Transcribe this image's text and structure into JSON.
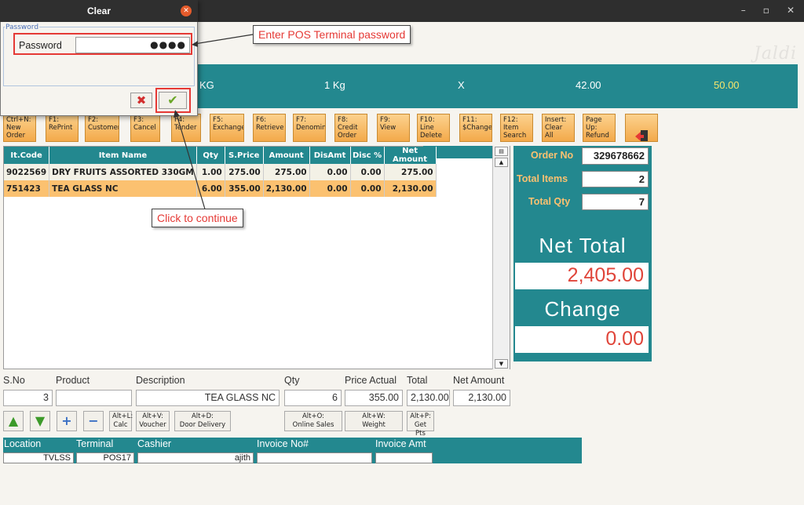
{
  "window": {
    "minimize": "–",
    "restore": "▫",
    "close": "✕",
    "logo": "Jaldi"
  },
  "dialog": {
    "title": "Clear",
    "close_glyph": "✕",
    "group_legend": "Password",
    "password_label": "Password",
    "password_value": "●●●●",
    "cancel_glyph": "✖",
    "ok_glyph": "✔"
  },
  "callouts": {
    "password": "Enter POS Terminal password",
    "continue": "Click to continue"
  },
  "product_bar": {
    "unit": "KG",
    "qty_unit": "1 Kg",
    "sep": "X",
    "price": "42.00",
    "total": "50.00"
  },
  "fkeys": [
    {
      "label": "Ctrl+N:\nNew\nOrder"
    },
    {
      "label": "F1:\nRePrint"
    },
    {
      "label": "F2:\nCustomer"
    },
    {
      "label": "F3:\nCancel"
    },
    {
      "label": "F4:\nTender"
    },
    {
      "label": "F5:\nExchange"
    },
    {
      "label": "F6:\nRetrieve"
    },
    {
      "label": "F7:\nDenomin."
    },
    {
      "label": "F8:\nCredit\nOrder"
    },
    {
      "label": "F9:\nView"
    },
    {
      "label": "F10:\nLine\nDelete"
    },
    {
      "label": "F11:\n$Change"
    },
    {
      "label": "F12:\nItem\nSearch"
    },
    {
      "label": "Insert:\nClear All"
    },
    {
      "label": "Page Up:\nRefund"
    }
  ],
  "table": {
    "headers": [
      "It.Code",
      "Item Name",
      "Qty",
      "S.Price",
      "Amount",
      "DisAmt",
      "Disc %",
      "Net Amount"
    ],
    "rows": [
      [
        "9022569",
        "DRY FRUITS ASSORTED 330GM",
        "1.00",
        "275.00",
        "275.00",
        "0.00",
        "0.00",
        "275.00"
      ],
      [
        "751423",
        "TEA GLASS NC",
        "6.00",
        "355.00",
        "2,130.00",
        "0.00",
        "0.00",
        "2,130.00"
      ]
    ]
  },
  "summary": {
    "order_no_label": "Order No",
    "order_no": "329678662",
    "total_items_label": "Total Items",
    "total_items": "2",
    "total_qty_label": "Total Qty",
    "total_qty": "7",
    "net_total_label": "Net Total",
    "net_total": "2,405.00",
    "change_label": "Change",
    "change": "0.00"
  },
  "entry": {
    "labels": {
      "sno": "S.No",
      "product": "Product",
      "description": "Description",
      "qty": "Qty",
      "price_actual": "Price Actual",
      "total": "Total",
      "net_amount": "Net Amount"
    },
    "sno": "3",
    "product": "",
    "description": "TEA GLASS NC",
    "qty": "6",
    "price_actual": "355.00",
    "total": "2,130.00",
    "net_amount": "2,130.00"
  },
  "action_buttons": {
    "calc": "Alt+L:\nCalc",
    "voucher": "Alt+V:\nVoucher",
    "door_delivery": "Alt+D:\nDoor Delivery",
    "online_sales": "Alt+O:\nOnline Sales",
    "weight": "Alt+W:\nWeight",
    "get_pts": "Alt+P:\nGet Pts"
  },
  "footer": {
    "location_label": "Location",
    "location": "TVLSS",
    "terminal_label": "Terminal",
    "terminal": "POS17",
    "cashier_label": "Cashier",
    "cashier": "ajith",
    "invoice_no_label": "Invoice No#",
    "invoice_no": "",
    "invoice_amt_label": "Invoice Amt",
    "invoice_amt": ""
  },
  "colors": {
    "teal": "#23888f",
    "orange": "#fbc170",
    "red": "#e53935"
  }
}
